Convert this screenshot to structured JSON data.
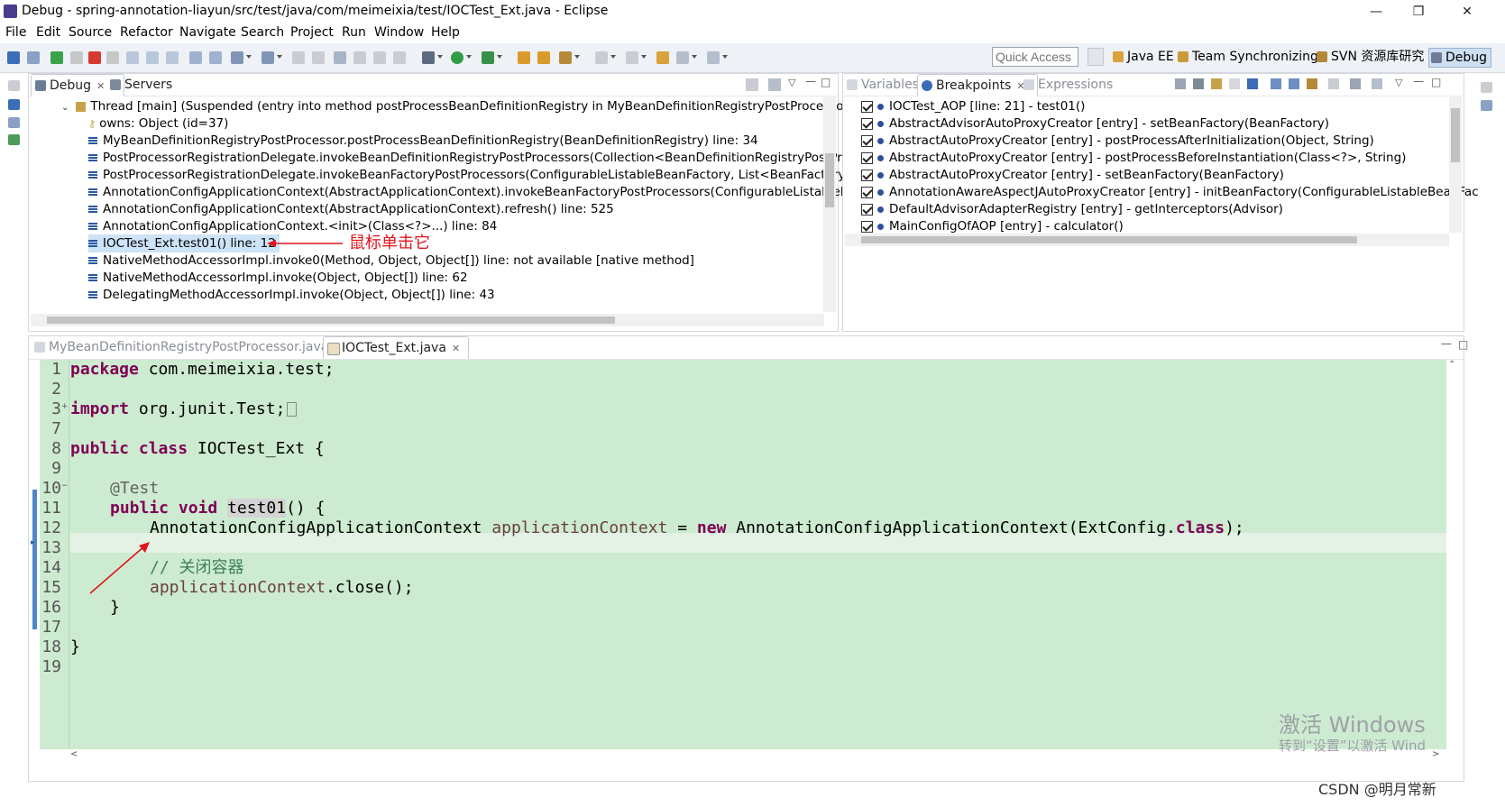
{
  "window": {
    "title": "Debug - spring-annotation-liayun/src/test/java/com/meimeixia/test/IOCTest_Ext.java - Eclipse",
    "controls": [
      "—",
      "❐",
      "✕"
    ]
  },
  "menu": [
    "File",
    "Edit",
    "Source",
    "Refactor",
    "Navigate",
    "Search",
    "Project",
    "Run",
    "Window",
    "Help"
  ],
  "toolbar": {
    "quick_access_placeholder": "Quick Access",
    "perspectives": [
      "Java EE",
      "Team Synchronizing",
      "SVN 资源库研究",
      "Debug"
    ],
    "active_perspective": "Debug"
  },
  "debug_view": {
    "tabs": [
      "Debug",
      "Servers"
    ],
    "thread": "Thread [main] (Suspended (entry into method postProcessBeanDefinitionRegistry in MyBeanDefinitionRegistryPostProcessor))",
    "owns": "owns: Object  (id=37)",
    "frames": [
      "MyBeanDefinitionRegistryPostProcessor.postProcessBeanDefinitionRegistry(BeanDefinitionRegistry) line: 34",
      "PostProcessorRegistrationDelegate.invokeBeanDefinitionRegistryPostProcessors(Collection<BeanDefinitionRegistryPostProce",
      "PostProcessorRegistrationDelegate.invokeBeanFactoryPostProcessors(ConfigurableListableBeanFactory, List<BeanFactoryPos",
      "AnnotationConfigApplicationContext(AbstractApplicationContext).invokeBeanFactoryPostProcessors(ConfigurableListableBe",
      "AnnotationConfigApplicationContext(AbstractApplicationContext).refresh() line: 525",
      "AnnotationConfigApplicationContext.<init>(Class<?>...) line: 84",
      "IOCTest_Ext.test01() line: 12",
      "NativeMethodAccessorImpl.invoke0(Method, Object, Object[]) line: not available [native method]",
      "NativeMethodAccessorImpl.invoke(Object, Object[]) line: 62",
      "DelegatingMethodAccessorImpl.invoke(Object, Object[]) line: 43"
    ],
    "selected_frame_index": 6,
    "annotation": "鼠标单击它"
  },
  "breakpoints_view": {
    "tabs": [
      "Variables",
      "Breakpoints",
      "Expressions"
    ],
    "active_tab": "Breakpoints",
    "items": [
      "IOCTest_AOP [line: 21] - test01()",
      "AbstractAdvisorAutoProxyCreator [entry] - setBeanFactory(BeanFactory)",
      "AbstractAutoProxyCreator [entry] - postProcessAfterInitialization(Object, String)",
      "AbstractAutoProxyCreator [entry] - postProcessBeforeInstantiation(Class<?>, String)",
      "AbstractAutoProxyCreator [entry] - setBeanFactory(BeanFactory)",
      "AnnotationAwareAspectJAutoProxyCreator [entry] - initBeanFactory(ConfigurableListableBeanFac",
      "DefaultAdvisorAdapterRegistry [entry] - getInterceptors(Advisor)",
      "MainConfigOfAOP [entry] - calculator()"
    ]
  },
  "editor": {
    "tabs": [
      "MyBeanDefinitionRegistryPostProcessor.java",
      "IOCTest_Ext.java"
    ],
    "active_tab": "IOCTest_Ext.java",
    "line_numbers": [
      "1",
      "2",
      "3",
      "7",
      "8",
      "9",
      "10",
      "11",
      "12",
      "13",
      "14",
      "15",
      "16",
      "17",
      "18",
      "19"
    ],
    "lines": {
      "l1_kw": "package",
      "l1_rest": " com.meimeixia.test;",
      "l3_kw": "import",
      "l3_rest": " org.junit.Test;",
      "l8_kw": "public class",
      "l8_rest": " IOCTest_Ext {",
      "l10": "@Test",
      "l11_kw": "public void",
      "l11_name": "test01",
      "l11_rest": "() {",
      "l12_type": "AnnotationConfigApplicationContext ",
      "l12_var": "applicationContext",
      "l12_eq": " = ",
      "l12_new": "new",
      "l12_rest": " AnnotationConfigApplicationContext(ExtConfig.",
      "l12_class": "class",
      "l12_end": ");",
      "l14": "// 关闭容器",
      "l15_var": "applicationContext",
      "l15_rest": ".close();",
      "l16": "}",
      "l18": "}"
    }
  },
  "watermarks": {
    "activate_line1": "激活 Windows",
    "activate_line2": "转到“设置”以激活 Wind",
    "csdn": "CSDN @明月常新"
  },
  "colors": {
    "editor_bg": "#cdebd0",
    "keyword": "#7f0055",
    "annotation_red": "#e0141c",
    "selection": "#cde3f7"
  }
}
